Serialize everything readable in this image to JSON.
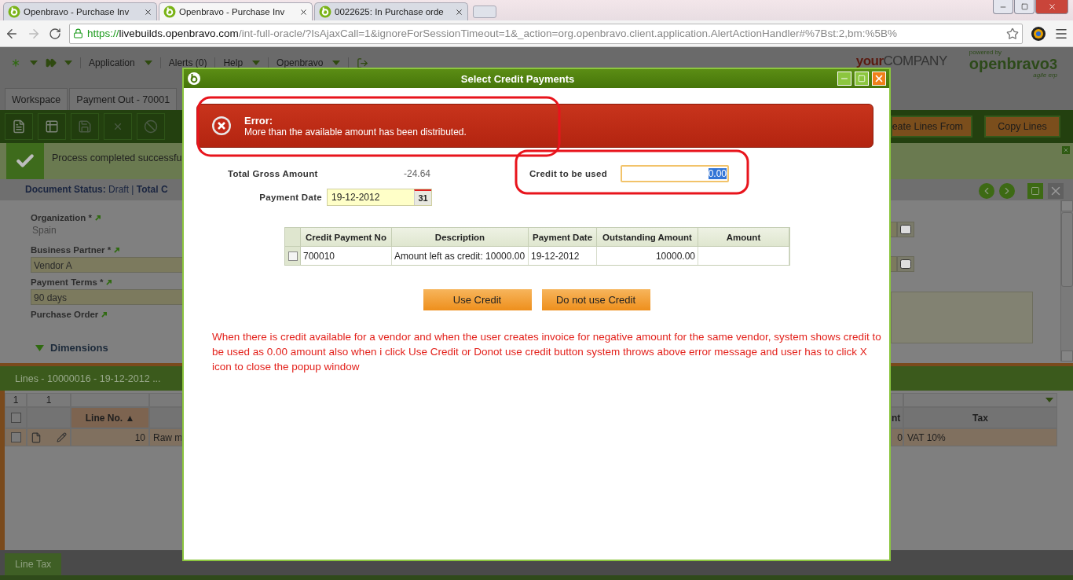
{
  "browser": {
    "tabs": [
      {
        "title": "Openbravo - Purchase Inv",
        "selected": false
      },
      {
        "title": "Openbravo - Purchase Inv",
        "selected": true
      },
      {
        "title": "0022625: In Purchase orde",
        "selected": false
      }
    ],
    "url": {
      "scheme": "https://",
      "host": "livebuilds.openbravo.com",
      "path": "/int-full-oracle/?IsAjaxCall=1&ignoreForSessionTimeout=1&_action=org.openbravo.client.application.AlertActionHandler#%7Bst:2,bm:%5B%"
    }
  },
  "nav": {
    "menus": [
      {
        "label": "Application",
        "has_menu": true
      },
      {
        "label": "Alerts (0)",
        "has_menu": false
      },
      {
        "label": "Help",
        "has_menu": true
      },
      {
        "label": "Openbravo",
        "has_menu": true
      }
    ],
    "company_logo": {
      "first": "your",
      "second": "COMPANY"
    },
    "vendor_logo": {
      "caption": "powered by",
      "name": "openbravo",
      "version": "3",
      "tagline": "agile erp"
    }
  },
  "workspace_tabs": [
    {
      "label": "Workspace"
    },
    {
      "label": "Payment Out - 70001"
    }
  ],
  "toolbar": {
    "buttons": [
      {
        "label": "eate Lines From"
      },
      {
        "label": "Copy Lines"
      }
    ]
  },
  "message": {
    "text": "Process completed successfu"
  },
  "status_bar": {
    "text": "**Document Status:** Draft  |  **Total C**"
  },
  "form": {
    "fields": [
      {
        "label": "Organization *",
        "value": "Spain",
        "kind": "readonly"
      },
      {
        "label": "Business Partner *",
        "value": "Vendor A",
        "kind": "input"
      },
      {
        "label": "Payment Terms *",
        "value": "90 days",
        "kind": "input"
      },
      {
        "label": "Purchase Order",
        "kind": "empty"
      }
    ],
    "section": {
      "label": "Dimensions",
      "expanded": true
    }
  },
  "lines": {
    "title": "Lines - 10000016 - 19-12-2012 ...",
    "filter_row": [
      "1",
      "1"
    ],
    "header_checked": false,
    "left_columns": [
      {
        "label": "Line No. ▲",
        "sorted": true
      }
    ],
    "right_columns": [
      {
        "label": "nt",
        "sorted": false
      },
      {
        "label": "Tax",
        "sorted": false
      }
    ],
    "rows": [
      {
        "checked": false,
        "line_no": "10",
        "column_3": "Raw m",
        "column_4": "0",
        "tax": "VAT 10%"
      }
    ]
  },
  "subtabs": [
    {
      "label": "Line Tax"
    }
  ],
  "dialog": {
    "title": "Select Credit Payments",
    "error": {
      "heading": "Error:",
      "message": "More than the available amount has been distributed."
    },
    "total_gross": {
      "label": "Total Gross Amount",
      "value": "-24.64"
    },
    "payment_date": {
      "label": "Payment Date",
      "value": "19-12-2012",
      "calendar": "31"
    },
    "credit": {
      "label": "Credit to be used",
      "value": "0.00",
      "text_selected": true
    },
    "table": {
      "columns": [
        "Credit Payment No",
        "Description",
        "Payment Date",
        "Outstanding Amount",
        "Amount"
      ],
      "rows": [
        {
          "checked": false,
          "cells": [
            "700010",
            "Amount left as credit: 10000.00",
            "19-12-2012",
            "10000.00",
            ""
          ]
        }
      ]
    },
    "buttons": [
      "Use Credit",
      "Do not use Credit"
    ],
    "note": "When there is credit available for a vendor and when the user creates invoice for negative amount for the same vendor, system shows credit to be used as 0.00 amount also when i click Use Credit or Donot use credit button system throws above error message and user has to click X icon to close the popup window"
  }
}
